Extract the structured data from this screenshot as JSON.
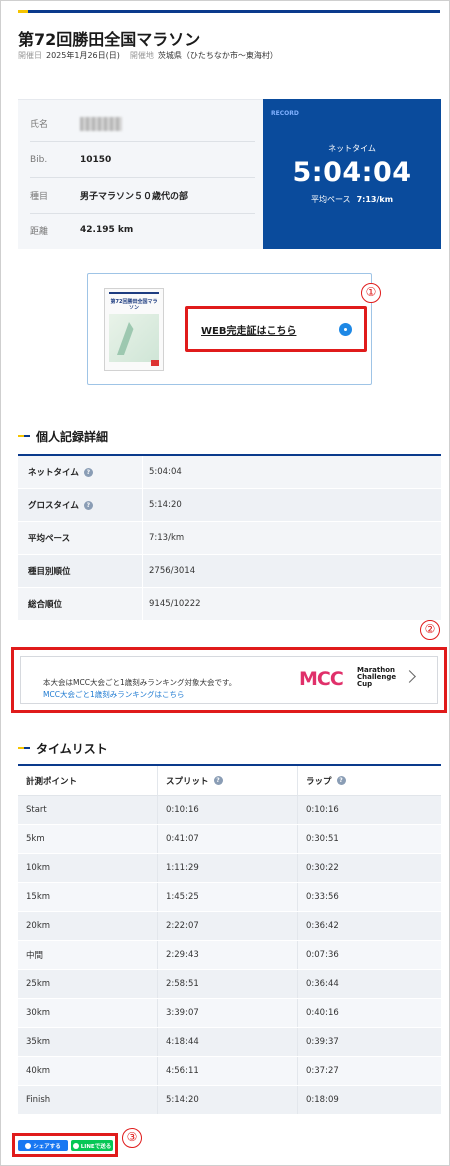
{
  "event": {
    "title": "第72回勝田全国マラソン",
    "date_label": "開催日",
    "date": "2025年1月26日(日)",
    "venue_label": "開催地",
    "venue": "茨城県（ひたちなか市〜東海村）"
  },
  "runner": {
    "name_label": "氏名",
    "bib_label": "Bib.",
    "bib": "10150",
    "category_label": "種目",
    "category": "男子マラソン５０歳代の部",
    "distance_label": "距離",
    "distance": "42.195 km"
  },
  "record": {
    "tag": "RECORD",
    "net_label": "ネットタイム",
    "net_time": "5:04:04",
    "pace_label": "平均ペース",
    "pace": "7:13/km"
  },
  "certificate": {
    "link_label": "WEB完走証はこちら",
    "thumb_title": "第72回勝田全国マラソン"
  },
  "annotations": [
    "①",
    "②",
    "③"
  ],
  "detail": {
    "title": "個人記録詳細",
    "rows": [
      {
        "label": "ネットタイム",
        "value": "5:04:04",
        "help": true
      },
      {
        "label": "グロスタイム",
        "value": "5:14:20",
        "help": true
      },
      {
        "label": "平均ペース",
        "value": "7:13/km",
        "help": false
      },
      {
        "label": "種目別順位",
        "value": "2756/3014",
        "help": false
      },
      {
        "label": "総合順位",
        "value": "9145/10222",
        "help": false
      }
    ]
  },
  "mcc": {
    "text": "本大会はMCC大会ごと1歳刻みランキング対象大会です。",
    "link": "MCC大会ごと1歳刻みランキングはこちら",
    "logo": "MCC",
    "logo_sub1": "Marathon",
    "logo_sub2": "Challenge",
    "logo_sub3": "Cup"
  },
  "timelist": {
    "title": "タイムリスト",
    "headers": [
      "計測ポイント",
      "スプリット",
      "ラップ"
    ],
    "rows": [
      [
        "Start",
        "0:10:16",
        "0:10:16"
      ],
      [
        "5km",
        "0:41:07",
        "0:30:51"
      ],
      [
        "10km",
        "1:11:29",
        "0:30:22"
      ],
      [
        "15km",
        "1:45:25",
        "0:33:56"
      ],
      [
        "20km",
        "2:22:07",
        "0:36:42"
      ],
      [
        "中間",
        "2:29:43",
        "0:07:36"
      ],
      [
        "25km",
        "2:58:51",
        "0:36:44"
      ],
      [
        "30km",
        "3:39:07",
        "0:40:16"
      ],
      [
        "35km",
        "4:18:44",
        "0:39:37"
      ],
      [
        "40km",
        "4:56:11",
        "0:37:27"
      ],
      [
        "Finish",
        "5:14:20",
        "0:18:09"
      ]
    ]
  },
  "share": {
    "facebook": "シェアする",
    "line": "LINEで送る"
  },
  "colors": {
    "brand_navy": "#0a3a8c",
    "record_bg": "#0a4b9c",
    "accent_yellow": "#f5c400",
    "annotation_red": "#e01b1b"
  }
}
